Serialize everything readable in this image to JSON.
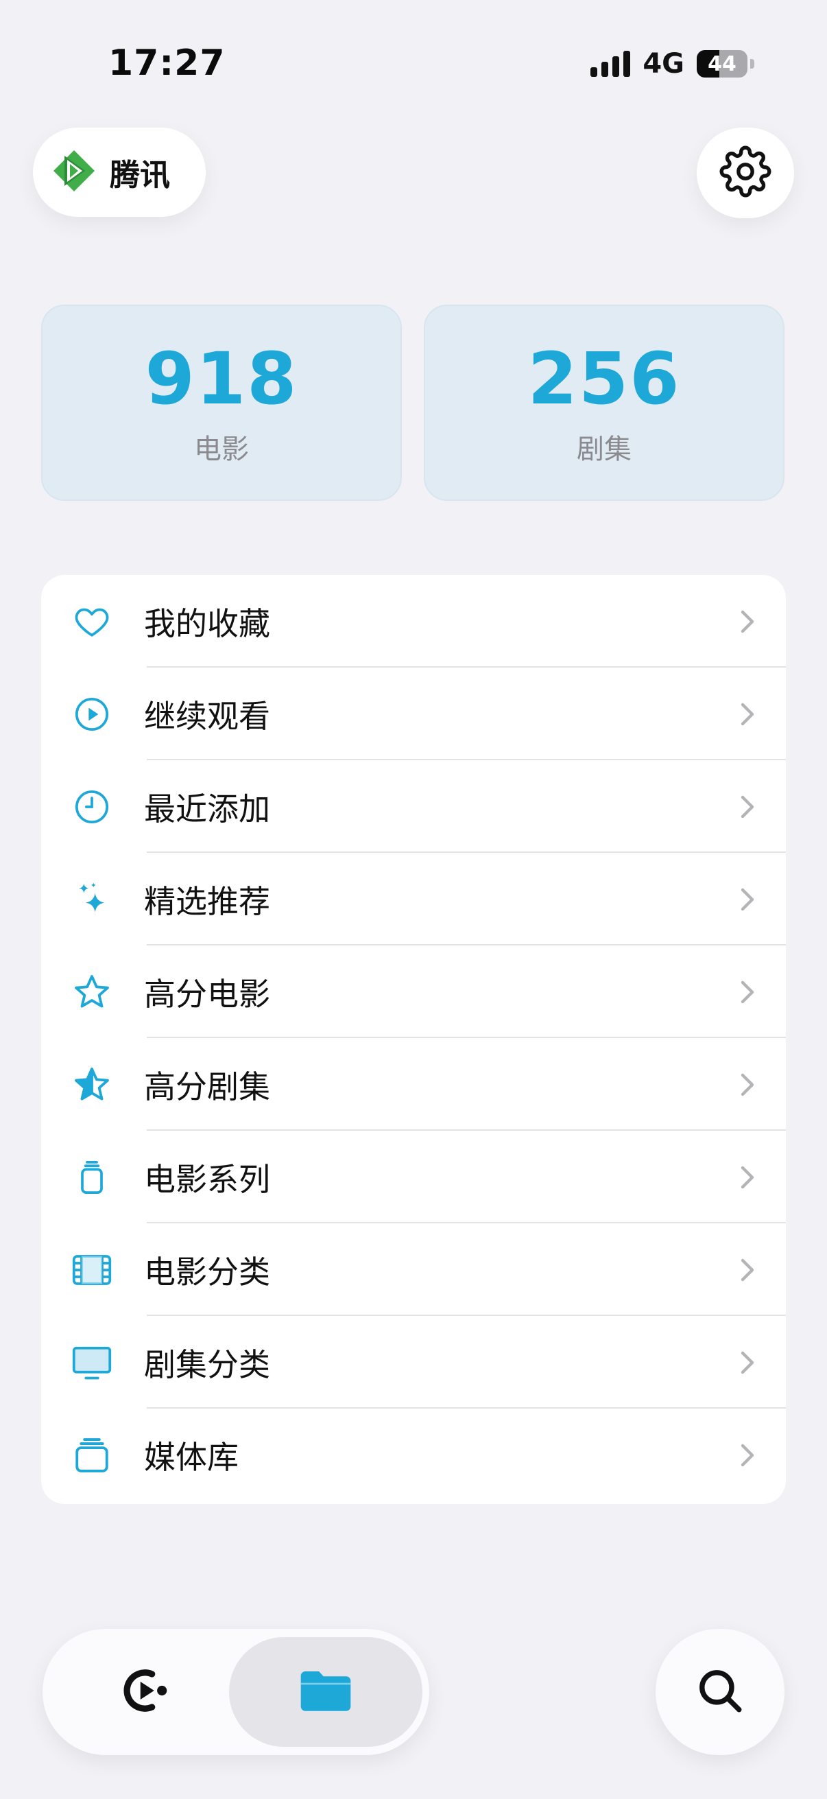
{
  "status_bar": {
    "time": "17:27",
    "network": "4G",
    "battery": "44",
    "battery_level_pct": 44
  },
  "header": {
    "source_label": "腾讯",
    "source_icon": "tencent-video-logo",
    "settings_icon": "gear-icon"
  },
  "stats": [
    {
      "value": "918",
      "label": "电影"
    },
    {
      "value": "256",
      "label": "剧集"
    }
  ],
  "menu": {
    "items": [
      {
        "label": "我的收藏",
        "icon": "heart-icon"
      },
      {
        "label": "继续观看",
        "icon": "play-circle-icon"
      },
      {
        "label": "最近添加",
        "icon": "clock-icon"
      },
      {
        "label": "精选推荐",
        "icon": "sparkles-icon"
      },
      {
        "label": "高分电影",
        "icon": "star-outline-icon"
      },
      {
        "label": "高分剧集",
        "icon": "star-half-icon"
      },
      {
        "label": "电影系列",
        "icon": "stack-icon"
      },
      {
        "label": "电影分类",
        "icon": "film-icon"
      },
      {
        "label": "剧集分类",
        "icon": "tv-icon"
      },
      {
        "label": "媒体库",
        "icon": "library-stack-icon"
      }
    ]
  },
  "tab_bar": {
    "tabs": [
      {
        "name": "home",
        "icon": "media-play-icon",
        "selected": false
      },
      {
        "name": "library",
        "icon": "folder-icon",
        "selected": true
      }
    ],
    "search_icon": "search-icon"
  },
  "colors": {
    "accent": "#1ea8d8",
    "background": "#f1f1f6",
    "card": "#ffffff",
    "stat_card": "#e1ebf3",
    "secondary_text": "#8a8a8f"
  }
}
